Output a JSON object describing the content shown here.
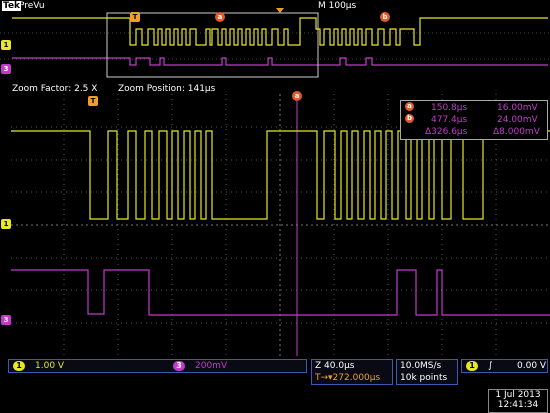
{
  "header": {
    "brand": "Tek",
    "mode": "PreVu",
    "timebase": "M 100µs"
  },
  "zoom": {
    "factor_label": "Zoom Factor: 2.5 X",
    "position_label": "Zoom Position: 141µs"
  },
  "cursor_readout": {
    "a_marker": "a",
    "b_marker": "b",
    "a_time": "150.8µs",
    "a_volt": "16.00mV",
    "b_time": "477.4µs",
    "b_volt": "24.00mV",
    "delta_time": "Δ326.6µs",
    "delta_volt": "Δ8.000mV"
  },
  "markers": {
    "trigger": "T",
    "ch1": "1",
    "ch3": "3",
    "cursor_a": "a",
    "cursor_b": "b"
  },
  "bottom": {
    "ch1_label": "1",
    "ch1_scale": "1.00 V",
    "ch3_label": "3",
    "ch3_scale": "200mV",
    "zoom_time": "Z 40.0µs",
    "trig_pos": "T→▾272.000µs",
    "sample_rate": "10.0MS/s",
    "record_len": "10k points",
    "trig_ch": "1",
    "trig_slope": "∫",
    "trig_level": "0.00 V",
    "date": "1 Jul  2013",
    "time": "12:41:34"
  },
  "colors": {
    "ch1": "#e6e62a",
    "ch3": "#c03cc8",
    "cursor": "#e25a2a",
    "accent": "#f0a020",
    "grid": "#555555",
    "box_border": "#3c5ab0"
  }
}
